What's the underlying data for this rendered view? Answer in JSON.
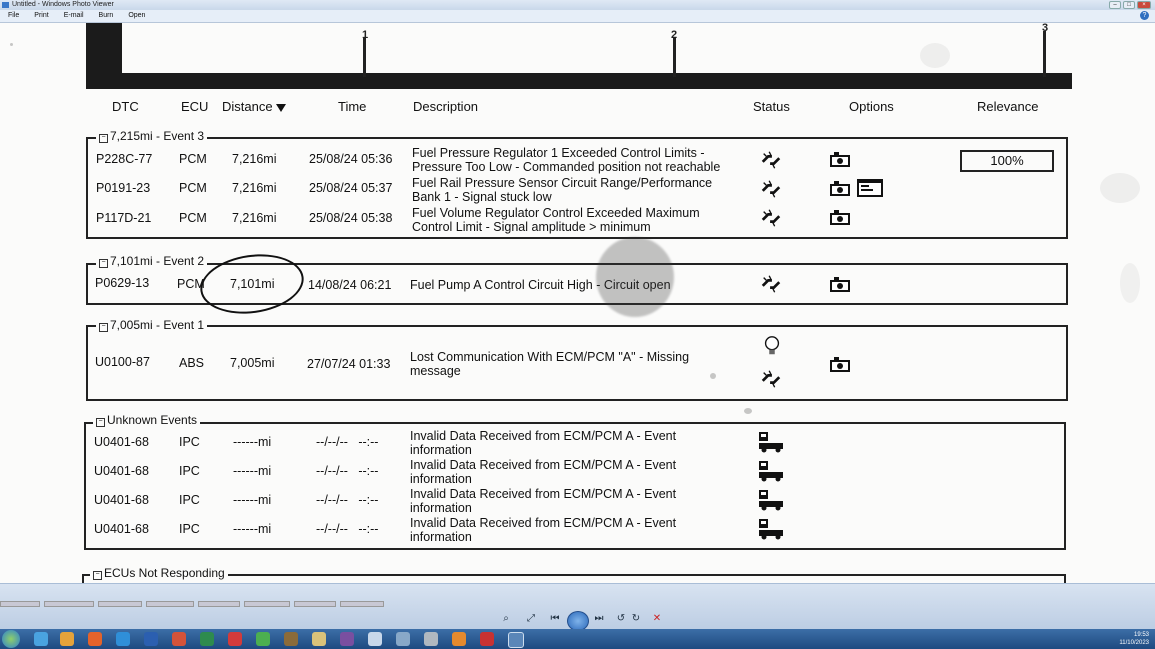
{
  "window": {
    "title": "Untitled - Windows Photo Viewer"
  },
  "menu": [
    "File",
    "Print",
    "E-mail",
    "Burn",
    "Open"
  ],
  "timeline": {
    "ticks": [
      "1",
      "2",
      "3"
    ]
  },
  "columns": {
    "dtc": "DTC",
    "ecu": "ECU",
    "distance": "Distance",
    "time": "Time",
    "description": "Description",
    "status": "Status",
    "options": "Options",
    "relevance": "Relevance"
  },
  "groups": [
    {
      "title": "7,215mi - Event 3",
      "rows": [
        {
          "dtc": "P228C-77",
          "ecu": "PCM",
          "distance": "7,216mi",
          "time": "25/08/24 05:36",
          "desc1": "Fuel Pressure Regulator 1 Exceeded Control Limits -",
          "desc2": "Pressure Too Low - Commanded position not reachable"
        },
        {
          "dtc": "P0191-23",
          "ecu": "PCM",
          "distance": "7,216mi",
          "time": "25/08/24 05:37",
          "desc1": "Fuel Rail Pressure Sensor Circuit Range/Performance",
          "desc2": "Bank 1 - Signal stuck low"
        },
        {
          "dtc": "P117D-21",
          "ecu": "PCM",
          "distance": "7,216mi",
          "time": "25/08/24 05:38",
          "desc1": "Fuel Volume Regulator Control Exceeded Maximum",
          "desc2": "Control Limit - Signal amplitude > minimum"
        }
      ],
      "relevance": "100%"
    },
    {
      "title": "7,101mi - Event 2",
      "rows": [
        {
          "dtc": "P0629-13",
          "ecu": "PCM",
          "distance": "7,101mi",
          "time": "14/08/24 06:21",
          "desc1": "Fuel Pump A Control Circuit High - Circuit open",
          "desc2": ""
        }
      ]
    },
    {
      "title": "7,005mi - Event 1",
      "rows": [
        {
          "dtc": "U0100-87",
          "ecu": "ABS",
          "distance": "7,005mi",
          "time": "27/07/24 01:33",
          "desc1": "Lost Communication With ECM/PCM \"A\" - Missing",
          "desc2": "message"
        }
      ]
    },
    {
      "title": "Unknown Events",
      "rows": [
        {
          "dtc": "U0401-68",
          "ecu": "IPC",
          "distance": "------mi",
          "time": "--/--/--   --:--",
          "desc1": "Invalid Data Received from ECM/PCM A - Event",
          "desc2": "information"
        },
        {
          "dtc": "U0401-68",
          "ecu": "IPC",
          "distance": "------mi",
          "time": "--/--/--   --:--",
          "desc1": "Invalid Data Received from ECM/PCM A - Event",
          "desc2": "information"
        },
        {
          "dtc": "U0401-68",
          "ecu": "IPC",
          "distance": "------mi",
          "time": "--/--/--   --:--",
          "desc1": "Invalid Data Received from ECM/PCM A - Event",
          "desc2": "information"
        },
        {
          "dtc": "U0401-68",
          "ecu": "IPC",
          "distance": "------mi",
          "time": "--/--/--   --:--",
          "desc1": "Invalid Data Received from ECM/PCM A - Event",
          "desc2": "information"
        }
      ]
    }
  ],
  "footer_group": {
    "title": "ECUs Not Responding"
  },
  "icons": {
    "status_fault": "broken-link-icon",
    "status_info": "lightbulb-icon",
    "status_vehicle": "vehicle-module-icon",
    "option_camera": "freeze-frame-icon",
    "option_dialog": "report-icon"
  },
  "tray": {
    "time": "19:53",
    "date": "11/10/2023"
  }
}
